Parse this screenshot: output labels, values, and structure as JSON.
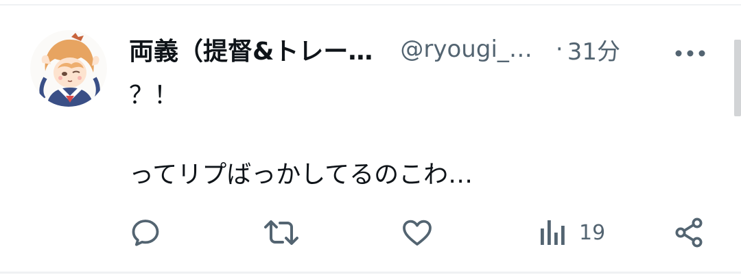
{
  "tweet": {
    "author": {
      "display_name": "両義（提督&トレー…",
      "handle": "@ryougi_…",
      "separator": "·",
      "time": "31分"
    },
    "text": {
      "line1": "？！",
      "line2": "",
      "line3": "ってリプばっかしてるのこわ…"
    },
    "actions": {
      "reply_icon": "reply-icon",
      "retweet_icon": "retweet-icon",
      "like_icon": "heart-icon",
      "views_icon": "bar-chart-icon",
      "views_count": "19",
      "share_icon": "share-icon"
    },
    "colors": {
      "text": "#0f1419",
      "secondary": "#536471",
      "divider": "#eff1f3"
    }
  }
}
